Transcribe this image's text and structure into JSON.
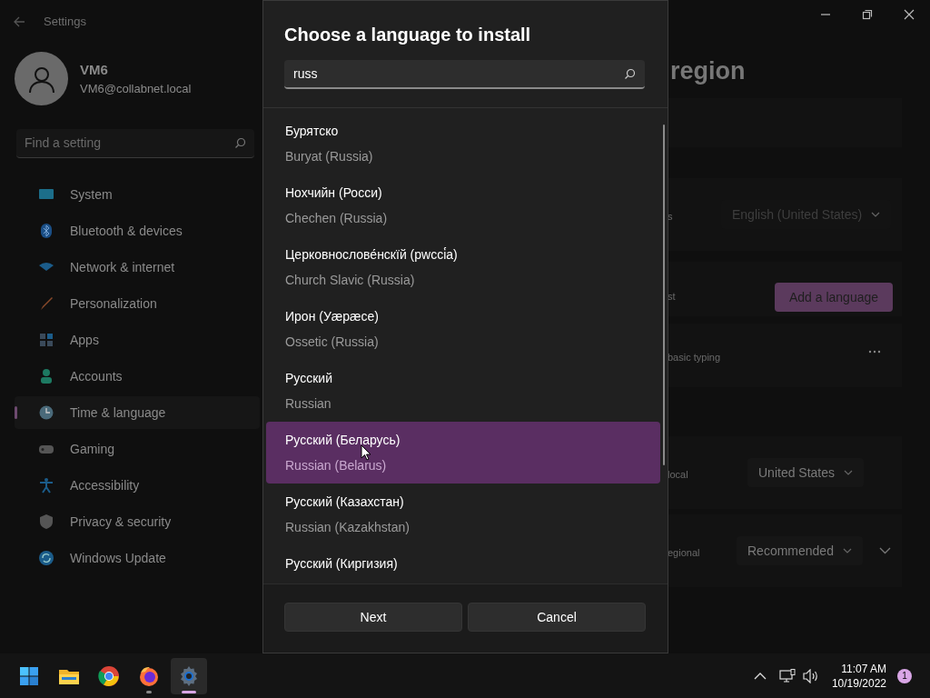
{
  "window": {
    "title": "Settings"
  },
  "account": {
    "name": "VM6",
    "email": "VM6@collabnet.local"
  },
  "sidebar": {
    "search": {
      "placeholder": "Find a setting"
    },
    "items": [
      {
        "label": "System",
        "selected": false
      },
      {
        "label": "Bluetooth & devices",
        "selected": false
      },
      {
        "label": "Network & internet",
        "selected": false
      },
      {
        "label": "Personalization",
        "selected": false
      },
      {
        "label": "Apps",
        "selected": false
      },
      {
        "label": "Accounts",
        "selected": false
      },
      {
        "label": "Time & language",
        "selected": true
      },
      {
        "label": "Gaming",
        "selected": false
      },
      {
        "label": "Accessibility",
        "selected": false
      },
      {
        "label": "Privacy & security",
        "selected": false
      },
      {
        "label": "Windows Update",
        "selected": false
      }
    ]
  },
  "page": {
    "heading": "region",
    "rows": [
      {
        "kind": "dropdown",
        "label": "s",
        "value": "English (United States)",
        "disabled": true
      },
      {
        "kind": "button",
        "label": "st",
        "value": "Add a language"
      },
      {
        "kind": "more",
        "label": "basic typing"
      },
      {
        "kind": "dropdown",
        "label": "local",
        "value": "United States",
        "disabled": false
      },
      {
        "kind": "dropdown-expand",
        "label": "egional",
        "value": "Recommended",
        "disabled": false
      }
    ]
  },
  "dialog": {
    "title": "Choose a language to install",
    "search": {
      "value": "russ"
    },
    "languages": [
      {
        "native": "Бурятско",
        "english": "Buryat (Russia)",
        "selected": false
      },
      {
        "native": "Нохчийн (Росси)",
        "english": "Chechen (Russia)",
        "selected": false
      },
      {
        "native": "Церковнослове́нскїй (рwссі́а)",
        "english": "Church Slavic (Russia)",
        "selected": false
      },
      {
        "native": "Ирон (Уæрæсе)",
        "english": "Ossetic (Russia)",
        "selected": false
      },
      {
        "native": "Русский",
        "english": "Russian",
        "selected": false
      },
      {
        "native": "Русский (Беларусь)",
        "english": "Russian (Belarus)",
        "selected": true
      },
      {
        "native": "Русский (Казахстан)",
        "english": "Russian (Kazakhstan)",
        "selected": false
      },
      {
        "native": "Русский (Киргизия)",
        "selected": false
      }
    ],
    "buttons": [
      "Next",
      "Cancel"
    ]
  },
  "taskbar": {
    "apps": [
      {
        "running": false,
        "active": false
      },
      {
        "running": false,
        "active": false
      },
      {
        "running": false,
        "active": false
      },
      {
        "running": true,
        "active": false
      },
      {
        "running": true,
        "active": true
      }
    ],
    "time": "11:07 AM",
    "date": "10/19/2022",
    "notifications": "1"
  }
}
